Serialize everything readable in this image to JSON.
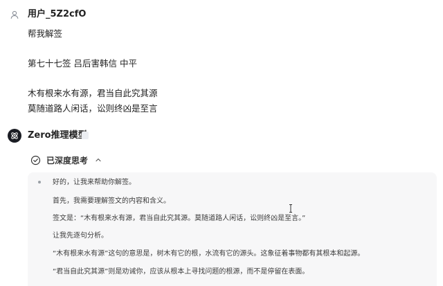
{
  "user": {
    "name": "用户_5Z2cfO",
    "message_lines": [
      "帮我解签",
      "第七十七签 吕后害韩信 中平",
      "木有根来水有源，君当自此究其源",
      "莫随道路人闲话，讼则终凶是至言"
    ]
  },
  "assistant": {
    "name": "Zero推理模型",
    "thinking_toggle_label": "已深度思考",
    "thinking_lines": [
      "好的，让我来帮助你解签。",
      "首先，我需要理解签文的内容和含义。",
      "签文是：“木有根来水有源，君当自此究其源。莫随道路人闲话，讼则终凶是至言。”",
      "让我先逐句分析。",
      "“木有根来水有源”这句的意思是，树木有它的根，水流有它的源头。这象征着事物都有其根本和起源。",
      "“君当自此究其源”则是劝诫你，应该从根本上寻找问题的根源，而不是停留在表面。"
    ]
  },
  "icons": {
    "user_avatar": "user-icon",
    "assistant_avatar": "zero-logo-icon",
    "thinking_status": "check-circle-icon",
    "collapse": "chevron-up-icon",
    "badge": "badge-icon",
    "cursor": "text-cursor-icon"
  },
  "colors": {
    "bot_avatar_bg": "#1b1d24",
    "panel_bg": "#f7f7f8"
  }
}
